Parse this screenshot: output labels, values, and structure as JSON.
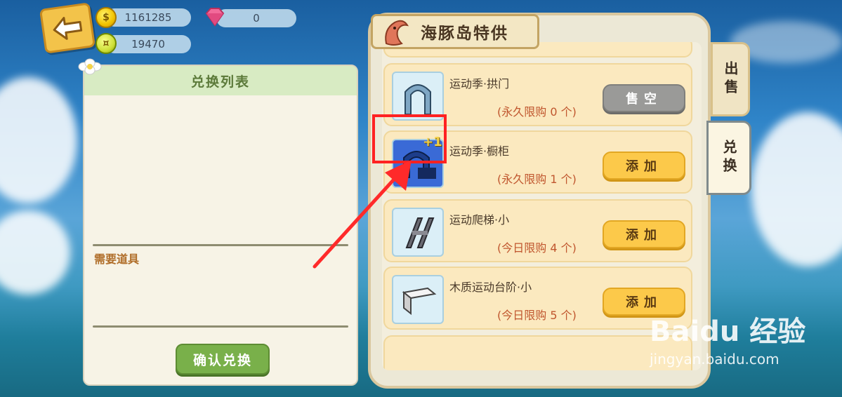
{
  "currencies": [
    {
      "value": "1161285",
      "icon": "gold-coin-icon"
    },
    {
      "value": "19470",
      "icon": "green-coin-icon"
    },
    {
      "value": "0",
      "icon": "gem-icon"
    }
  ],
  "exchange_list": {
    "title": "兑换列表",
    "needed_label": "需要道具",
    "confirm_label": "确认兑换"
  },
  "shop": {
    "title": "海豚岛特供",
    "tabs": [
      {
        "label": "出售",
        "selected": false
      },
      {
        "label": "兑换",
        "selected": true
      }
    ],
    "items": [
      {
        "name": "运动季·拱门",
        "limit": "(永久限购  0 个)",
        "button": "售空",
        "state": "sold-out"
      },
      {
        "name": "运动季·橱柜",
        "limit": "(永久限购  1 个)",
        "button": "添加",
        "state": "available"
      },
      {
        "name": "运动爬梯·小",
        "limit": "(今日限购  4 个)",
        "button": "添加",
        "state": "available"
      },
      {
        "name": "木质运动台阶·小",
        "limit": "(今日限购  5 个)",
        "button": "添加",
        "state": "available"
      }
    ]
  },
  "annotation": {
    "plus_one": "+1"
  },
  "watermark": {
    "main": "Baidu 经验",
    "sub": "jingyan.baidu.com"
  },
  "colors": {
    "add_button": "#fcc94a",
    "sold_button": "#9a9a98",
    "highlight": "#ff2222"
  }
}
